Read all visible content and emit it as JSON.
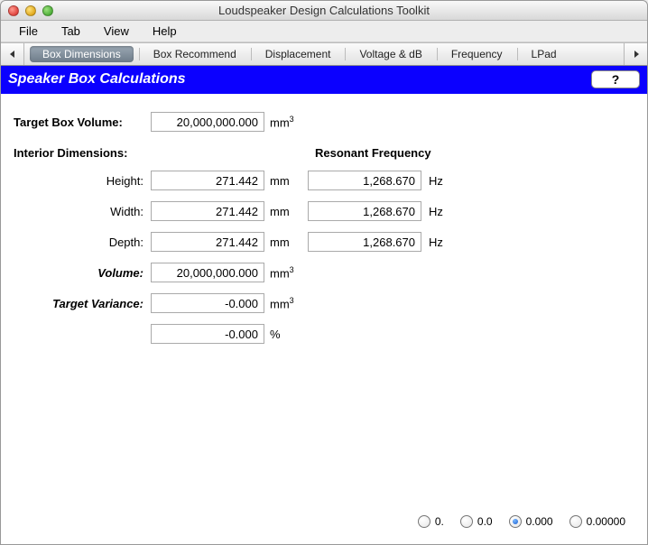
{
  "window": {
    "title": "Loudspeaker Design Calculations Toolkit"
  },
  "menubar": {
    "items": [
      "File",
      "Tab",
      "View",
      "Help"
    ]
  },
  "tabs": {
    "items": [
      "Box Dimensions",
      "Box Recommend",
      "Displacement",
      "Voltage & dB",
      "Frequency",
      "LPad"
    ],
    "active_index": 0
  },
  "header": {
    "title": "Speaker Box Calculations",
    "help_label": "?"
  },
  "form": {
    "target_volume": {
      "label": "Target Box Volume:",
      "value": "20,000,000.000",
      "unit": "mm",
      "unit_exp": "3"
    },
    "section_left": "Interior Dimensions:",
    "section_right": "Resonant Frequency",
    "height": {
      "label": "Height:",
      "value": "271.442",
      "unit": "mm",
      "freq": "1,268.670",
      "freq_unit": "Hz"
    },
    "width": {
      "label": "Width:",
      "value": "271.442",
      "unit": "mm",
      "freq": "1,268.670",
      "freq_unit": "Hz"
    },
    "depth": {
      "label": "Depth:",
      "value": "271.442",
      "unit": "mm",
      "freq": "1,268.670",
      "freq_unit": "Hz"
    },
    "volume": {
      "label": "Volume:",
      "value": "20,000,000.000",
      "unit": "mm",
      "unit_exp": "3"
    },
    "variance_mm": {
      "label": "Target Variance:",
      "value": "-0.000",
      "unit": "mm",
      "unit_exp": "3"
    },
    "variance_pct": {
      "value": "-0.000",
      "unit": "%"
    }
  },
  "precision": {
    "options": [
      "0.",
      "0.0",
      "0.000",
      "0.00000"
    ],
    "selected_index": 2
  }
}
